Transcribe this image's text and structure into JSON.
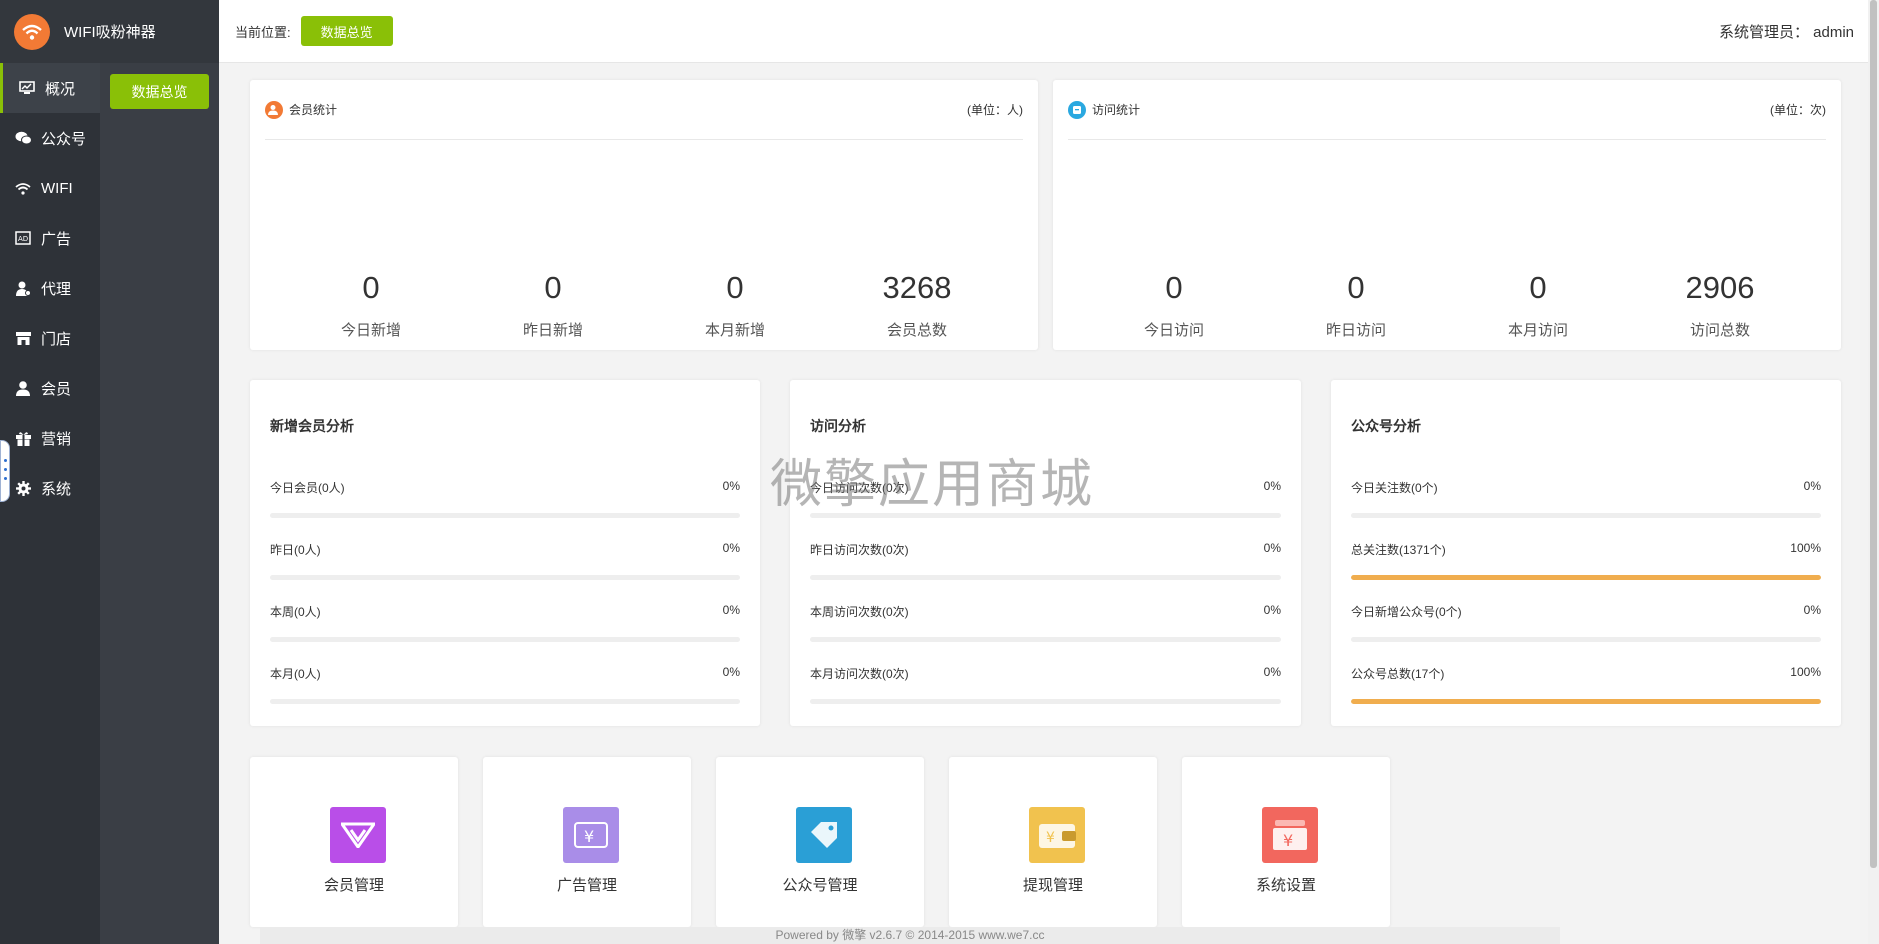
{
  "app": {
    "title": "WIFI吸粉神器"
  },
  "nav": [
    {
      "label": "概况",
      "icon": "monitor-icon"
    },
    {
      "label": "公众号",
      "icon": "wechat-icon"
    },
    {
      "label": "WIFI",
      "icon": "wifi-icon"
    },
    {
      "label": "广告",
      "icon": "ad-icon"
    },
    {
      "label": "代理",
      "icon": "agent-icon"
    },
    {
      "label": "门店",
      "icon": "store-icon"
    },
    {
      "label": "会员",
      "icon": "user-icon"
    },
    {
      "label": "营销",
      "icon": "gift-icon"
    },
    {
      "label": "系统",
      "icon": "gear-icon"
    }
  ],
  "subnav": {
    "button": "数据总览"
  },
  "header": {
    "crumb_label": "当前位置:",
    "crumb_button": "数据总览",
    "admin": "系统管理员： admin"
  },
  "member_stats": {
    "title": "会员统计",
    "unit": "(单位：人)",
    "items": [
      {
        "value": "0",
        "label": "今日新增"
      },
      {
        "value": "0",
        "label": "昨日新增"
      },
      {
        "value": "0",
        "label": "本月新增"
      },
      {
        "value": "3268",
        "label": "会员总数"
      }
    ]
  },
  "visit_stats": {
    "title": "访问统计",
    "unit": "(单位：次)",
    "items": [
      {
        "value": "0",
        "label": "今日访问"
      },
      {
        "value": "0",
        "label": "昨日访问"
      },
      {
        "value": "0",
        "label": "本月访问"
      },
      {
        "value": "2906",
        "label": "访问总数"
      }
    ]
  },
  "analysis": [
    {
      "title": "新增会员分析",
      "rows": [
        {
          "label": "今日会员(0人)",
          "percent": "0%",
          "value": 0
        },
        {
          "label": "昨日(0人)",
          "percent": "0%",
          "value": 0
        },
        {
          "label": "本周(0人)",
          "percent": "0%",
          "value": 0
        },
        {
          "label": "本月(0人)",
          "percent": "0%",
          "value": 0
        }
      ]
    },
    {
      "title": "访问分析",
      "rows": [
        {
          "label": "今日访问次数(0次)",
          "percent": "0%",
          "value": 0
        },
        {
          "label": "昨日访问次数(0次)",
          "percent": "0%",
          "value": 0
        },
        {
          "label": "本周访问次数(0次)",
          "percent": "0%",
          "value": 0
        },
        {
          "label": "本月访问次数(0次)",
          "percent": "0%",
          "value": 0
        }
      ]
    },
    {
      "title": "公众号分析",
      "rows": [
        {
          "label": "今日关注数(0个)",
          "percent": "0%",
          "value": 0
        },
        {
          "label": "总关注数(1371个)",
          "percent": "100%",
          "value": 100
        },
        {
          "label": "今日新增公众号(0个)",
          "percent": "0%",
          "value": 0
        },
        {
          "label": "公众号总数(17个)",
          "percent": "100%",
          "value": 100
        }
      ]
    }
  ],
  "shortcuts": [
    {
      "label": "会员管理",
      "icon": "vip-icon",
      "color": "#b94ee8"
    },
    {
      "label": "广告管理",
      "icon": "coupon-icon",
      "color": "#a98de8"
    },
    {
      "label": "公众号管理",
      "icon": "tag-icon",
      "color": "#2a9fd6"
    },
    {
      "label": "提现管理",
      "icon": "wallet-icon",
      "color": "#f1c24e"
    },
    {
      "label": "系统设置",
      "icon": "cash-icon",
      "color": "#f2675e"
    }
  ],
  "colors": {
    "accent": "#8ac007",
    "progress": "#f0ad4e",
    "sidebar": "#2e3238"
  },
  "watermark": "微擎应用商城",
  "footer": "Powered by 微擎 v2.6.7 © 2014-2015 www.we7.cc"
}
